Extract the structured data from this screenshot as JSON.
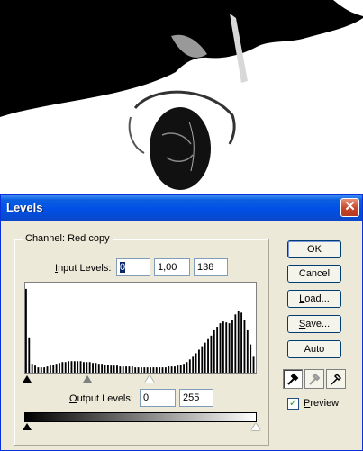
{
  "dialog": {
    "title": "Levels",
    "close_glyph": "✕",
    "channel_label": "Channel:",
    "channel_value": "Red copy",
    "input_levels": {
      "label_prefix": "I",
      "label_rest": "nput Levels:",
      "black": "0",
      "gamma": "1,00",
      "white": "138"
    },
    "output_levels": {
      "label_prefix": "O",
      "label_rest": "utput Levels:",
      "black": "0",
      "white": "255"
    },
    "buttons": {
      "ok": "OK",
      "cancel": "Cancel",
      "load_prefix": "L",
      "load_rest": "oad...",
      "save_prefix": "S",
      "save_rest": "ave...",
      "auto": "Auto"
    },
    "preview": {
      "checked": true,
      "check_glyph": "✓",
      "label_prefix": "P",
      "label_rest": "review"
    },
    "eyedroppers": [
      "black-eyedropper-icon",
      "gray-eyedropper-icon",
      "white-eyedropper-icon"
    ],
    "histogram_profile": [
      95,
      40,
      10,
      8,
      6,
      6,
      6,
      7,
      8,
      9,
      10,
      11,
      12,
      12,
      13,
      13,
      13,
      13,
      13,
      12,
      12,
      12,
      11,
      11,
      10,
      10,
      9,
      9,
      8,
      8,
      8,
      7,
      7,
      7,
      7,
      7,
      6,
      6,
      6,
      6,
      6,
      6,
      6,
      6,
      6,
      6,
      6,
      7,
      7,
      7,
      8,
      9,
      10,
      12,
      15,
      18,
      22,
      26,
      30,
      34,
      38,
      42,
      48,
      52,
      56,
      58,
      57,
      56,
      60,
      66,
      70,
      68,
      60,
      48,
      32,
      18
    ]
  }
}
